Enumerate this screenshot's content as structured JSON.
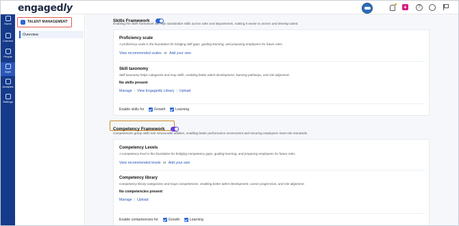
{
  "app": {
    "logo_text": "engaged",
    "logo_suffix": "ly"
  },
  "leftnav": {
    "items": [
      {
        "label": "Home",
        "icon": "home-icon"
      },
      {
        "label": "Connect",
        "icon": "connect-icon"
      },
      {
        "label": "People",
        "icon": "people-icon"
      },
      {
        "label": "Apps",
        "icon": "apps-icon"
      },
      {
        "label": "Analytics",
        "icon": "analytics-icon"
      },
      {
        "label": "Settings",
        "icon": "settings-icon"
      }
    ]
  },
  "header_icons": [
    "mascot-icon",
    "bell-icon",
    "plus-icon",
    "help-icon",
    "clock-icon",
    "flag-icon"
  ],
  "subnav": {
    "module_label": "TALENT MANAGEMENT",
    "items": [
      {
        "label": "Overview"
      }
    ]
  },
  "skills": {
    "title": "Skills Framework",
    "description": "Enabling the skills framework will help standardize skills across roles and departments, making it easier to assess and develop talent.",
    "proficiency": {
      "title": "Proficiency scale",
      "description": "A proficiency scale is the foundation for bridging skill gaps, guiding learning, and preparing employees for future roles.",
      "link1": "View recommended scales",
      "or": "or",
      "link2": "Add your own"
    },
    "taxonomy": {
      "title": "Skill taxonomy",
      "description": "Skill taxonomy helps categorize and map skills, enabling better talent development, learning pathways, and role alignment.",
      "status": "No skills present",
      "links": [
        "Manage",
        "View Engagedly Library",
        "Upload"
      ]
    },
    "enable": {
      "label": "Enable skills for",
      "options": [
        "Growth",
        "Learning"
      ]
    }
  },
  "competency": {
    "title": "Competency Framework",
    "description": "Competencies group skills into measurable abilities, enabling better performance assessment and ensuring employees meet role standards.",
    "levels": {
      "title": "Competency Levels",
      "description": "A competency level is the foundation for bridging competency gaps, guiding learning, and preparing employees for future roles.",
      "link1": "View recommended levels",
      "or": "or",
      "link2": "Add your own"
    },
    "library": {
      "title": "Competency library",
      "description": "Competency library categorizes and maps competencies, enabling better talent development, career progression, and role alignment.",
      "status": "No competencies present",
      "links": [
        "Manage",
        "Upload"
      ]
    },
    "enable": {
      "label": "Enable competencies for",
      "options": [
        "Growth",
        "Learning"
      ]
    }
  },
  "colors": {
    "nav_bg": "#163a8a",
    "accent": "#2a67d8",
    "competency_toggle": "#6a3fd6",
    "highlight_red": "#e2574c",
    "highlight_orange": "#c98a2b"
  }
}
